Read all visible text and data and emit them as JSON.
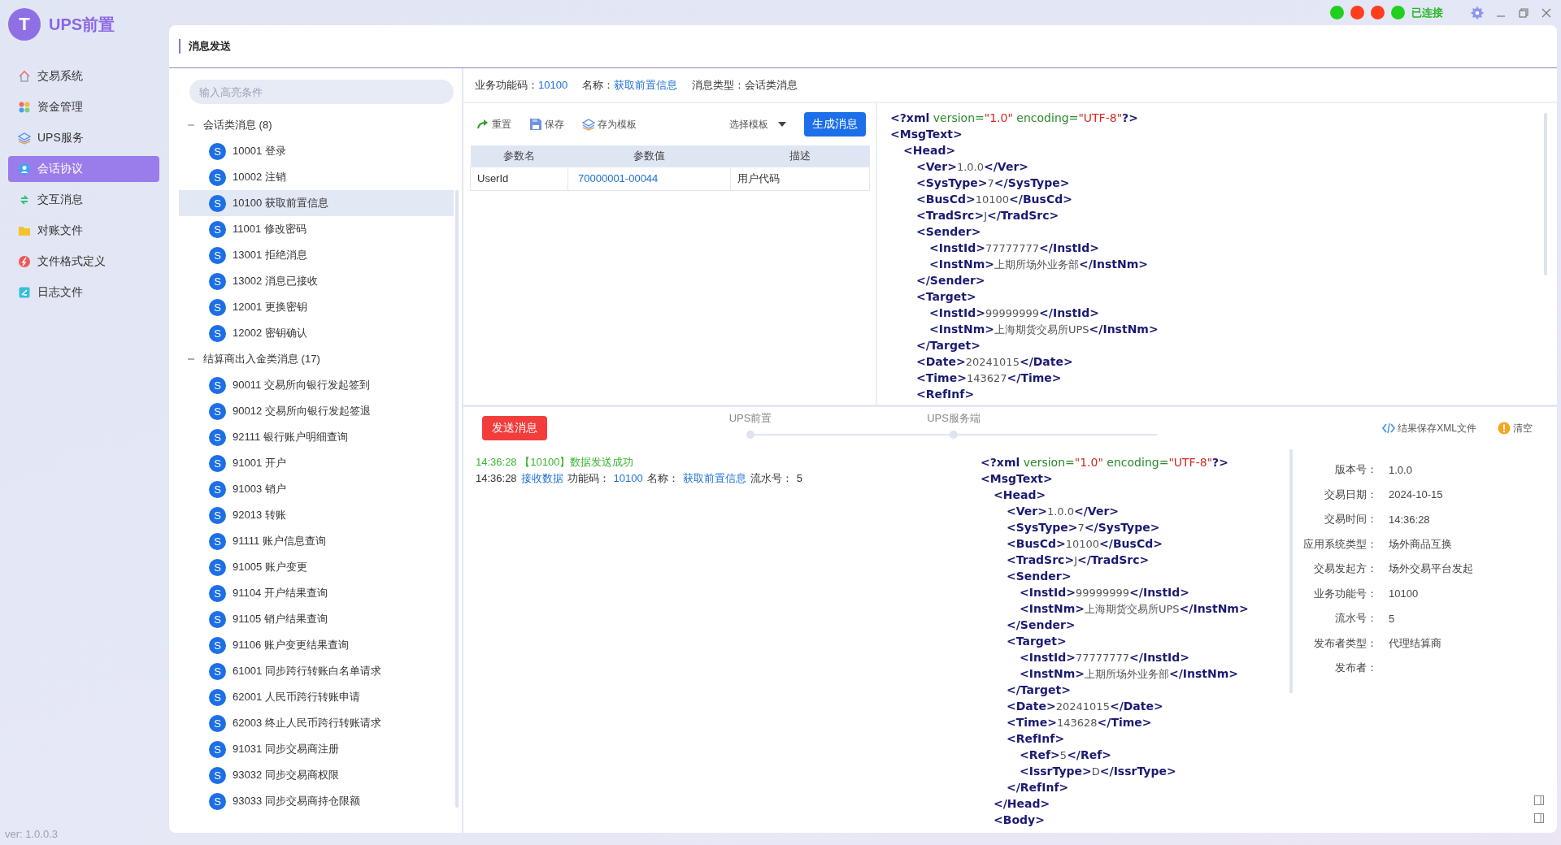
{
  "app": {
    "logo_letter": "T",
    "title": "UPS前置",
    "version": "ver: 1.0.0.3"
  },
  "nav": [
    {
      "label": "交易系统",
      "selected": false
    },
    {
      "label": "资金管理",
      "selected": false
    },
    {
      "label": "UPS服务",
      "selected": false
    },
    {
      "label": "会话协议",
      "selected": true
    },
    {
      "label": "交互消息",
      "selected": false
    },
    {
      "label": "对账文件",
      "selected": false
    },
    {
      "label": "文件格式定义",
      "selected": false
    },
    {
      "label": "日志文件",
      "selected": false
    }
  ],
  "status": {
    "indicators": [
      {
        "color": "#1fd01f"
      },
      {
        "color": "#ff3d1f"
      },
      {
        "color": "#ff3d1f"
      },
      {
        "color": "#1fd01f"
      }
    ],
    "text": "已连接"
  },
  "page_title": "消息发送",
  "tree": {
    "search": {
      "placeholder": "输入高亮条件"
    },
    "groups": [
      {
        "label": "会话类消息 (8)",
        "expanded": true,
        "children": [
          {
            "badge": "S",
            "label": "10001 登录",
            "selected": false
          },
          {
            "badge": "S",
            "label": "10002 注销",
            "selected": false
          },
          {
            "badge": "S",
            "label": "10100 获取前置信息",
            "selected": true
          },
          {
            "badge": "S",
            "label": "11001 修改密码",
            "selected": false
          },
          {
            "badge": "S",
            "label": "13001 拒绝消息",
            "selected": false
          },
          {
            "badge": "S",
            "label": "13002 消息已接收",
            "selected": false
          },
          {
            "badge": "S",
            "label": "12001 更换密钥",
            "selected": false
          },
          {
            "badge": "S",
            "label": "12002 密钥确认",
            "selected": false
          }
        ]
      },
      {
        "label": "结算商出入金类消息 (17)",
        "expanded": true,
        "children": [
          {
            "badge": "S",
            "label": "90011 交易所向银行发起签到",
            "selected": false
          },
          {
            "badge": "S",
            "label": "90012 交易所向银行发起签退",
            "selected": false
          },
          {
            "badge": "S",
            "label": "92111 银行账户明细查询",
            "selected": false
          },
          {
            "badge": "S",
            "label": "91001 开户",
            "selected": false
          },
          {
            "badge": "S",
            "label": "91003 销户",
            "selected": false
          },
          {
            "badge": "S",
            "label": "92013 转账",
            "selected": false
          },
          {
            "badge": "S",
            "label": "91111 账户信息查询",
            "selected": false
          },
          {
            "badge": "S",
            "label": "91005 账户变更",
            "selected": false
          },
          {
            "badge": "S",
            "label": "91104 开户结果查询",
            "selected": false
          },
          {
            "badge": "S",
            "label": "91105 销户结果查询",
            "selected": false
          },
          {
            "badge": "S",
            "label": "91106 账户变更结果查询",
            "selected": false
          },
          {
            "badge": "S",
            "label": "61001 同步跨行转账白名单请求",
            "selected": false
          },
          {
            "badge": "S",
            "label": "62001 人民币跨行转账申请",
            "selected": false
          },
          {
            "badge": "S",
            "label": "62003 终止人民币跨行转账请求",
            "selected": false
          },
          {
            "badge": "S",
            "label": "91031 同步交易商注册",
            "selected": false
          },
          {
            "badge": "S",
            "label": "93032 同步交易商权限",
            "selected": false
          },
          {
            "badge": "S",
            "label": "93033 同步交易商持仓限额",
            "selected": false
          }
        ]
      }
    ]
  },
  "message_info": [
    {
      "label": "业务功能码：",
      "value": "10100",
      "accent": true
    },
    {
      "label": "名称：",
      "value": "获取前置信息",
      "accent": true
    },
    {
      "label": "消息类型：",
      "value": "会话类消息",
      "accent": false
    }
  ],
  "toolbar": {
    "actions": [
      {
        "label": "重置"
      },
      {
        "label": "保存"
      },
      {
        "label": "存为模板"
      }
    ],
    "template_select": {
      "placeholder": "选择模板"
    },
    "generate_button": "生成消息"
  },
  "params": {
    "columns": [
      "参数名",
      "参数值",
      "描述"
    ],
    "rows": [
      {
        "name": "UserId",
        "value": "70000001-00044",
        "description": "用户代码"
      }
    ]
  },
  "request_xml": [
    {
      "line": "<?xml version=\"1.0\" encoding=\"UTF-8\"?>"
    },
    {
      "open": "<MsgText>",
      "children": [
        {
          "open": "<Head>",
          "children": [
            {
              "line": "<Ver>1.0.0</Ver>"
            },
            {
              "line": "<SysType>7</SysType>"
            },
            {
              "line": "<BusCd>10100</BusCd>"
            },
            {
              "line": "<TradSrc>J</TradSrc>"
            },
            {
              "open": "<Sender>",
              "children": [
                {
                  "line": "<InstId>77777777</InstId>"
                },
                {
                  "line": "<InstNm>上期所场外业务部</InstNm>"
                }
              ],
              "close": "</Sender>"
            },
            {
              "open": "<Target>",
              "children": [
                {
                  "line": "<InstId>99999999</InstId>"
                },
                {
                  "line": "<InstNm>上海期货交易所UPS</InstNm>"
                }
              ],
              "close": "</Target>"
            },
            {
              "line": "<Date>20241015</Date>"
            },
            {
              "line": "<Time>143627</Time>"
            },
            {
              "open": "<RefInf>"
            }
          ]
        }
      ]
    }
  ],
  "send_button": "发送消息",
  "steps": [
    {
      "label": "UPS前置"
    },
    {
      "label": "UPS服务端"
    }
  ],
  "result_actions": [
    {
      "label": "结果保存XML文件"
    },
    {
      "label": "清空"
    }
  ],
  "log": [
    {
      "kind": "success",
      "text": "14:36:28 【10100】数据发送成功"
    },
    {
      "kind": "detail",
      "parts": [
        {
          "text": "14:36:28",
          "accent": false
        },
        {
          "text": "接收数据",
          "accent": true
        },
        {
          "text": "功能码：",
          "accent": false
        },
        {
          "text": "10100",
          "accent": true
        },
        {
          "text": "名称：",
          "accent": false
        },
        {
          "text": "获取前置信息",
          "accent": true
        },
        {
          "text": "流水号：",
          "accent": false
        },
        {
          "text": "5",
          "accent": false
        }
      ]
    }
  ],
  "response_xml": [
    {
      "line": "<?xml version=\"1.0\" encoding=\"UTF-8\"?>"
    },
    {
      "open": "<MsgText>",
      "children": [
        {
          "open": "<Head>",
          "children": [
            {
              "line": "<Ver>1.0.0</Ver>"
            },
            {
              "line": "<SysType>7</SysType>"
            },
            {
              "line": "<BusCd>10100</BusCd>"
            },
            {
              "line": "<TradSrc>J</TradSrc>"
            },
            {
              "open": "<Sender>",
              "children": [
                {
                  "line": "<InstId>99999999</InstId>"
                },
                {
                  "line": "<InstNm>上海期货交易所UPS</InstNm>"
                }
              ],
              "close": "</Sender>"
            },
            {
              "open": "<Target>",
              "children": [
                {
                  "line": "<InstId>77777777</InstId>"
                },
                {
                  "line": "<InstNm>上期所场外业务部</InstNm>"
                }
              ],
              "close": "</Target>"
            },
            {
              "line": "<Date>20241015</Date>"
            },
            {
              "line": "<Time>143628</Time>"
            },
            {
              "open": "<RefInf>",
              "children": [
                {
                  "line": "<Ref>5</Ref>"
                },
                {
                  "line": "<IssrType>D</IssrType>"
                }
              ],
              "close": "</RefInf>"
            }
          ],
          "close": "</Head>"
        },
        {
          "open": "<Body>"
        }
      ]
    }
  ],
  "details": [
    {
      "label": "版本号：",
      "value": "1.0.0"
    },
    {
      "label": "交易日期：",
      "value": "2024-10-15"
    },
    {
      "label": "交易时间：",
      "value": "14:36:28"
    },
    {
      "label": "应用系统类型：",
      "value": "场外商品互换"
    },
    {
      "label": "交易发起方：",
      "value": "场外交易平台发起"
    },
    {
      "label": "业务功能号：",
      "value": "10100"
    },
    {
      "label": "流水号：",
      "value": "5"
    },
    {
      "label": "发布者类型：",
      "value": "代理结算商"
    },
    {
      "label": "发布者："
    }
  ]
}
